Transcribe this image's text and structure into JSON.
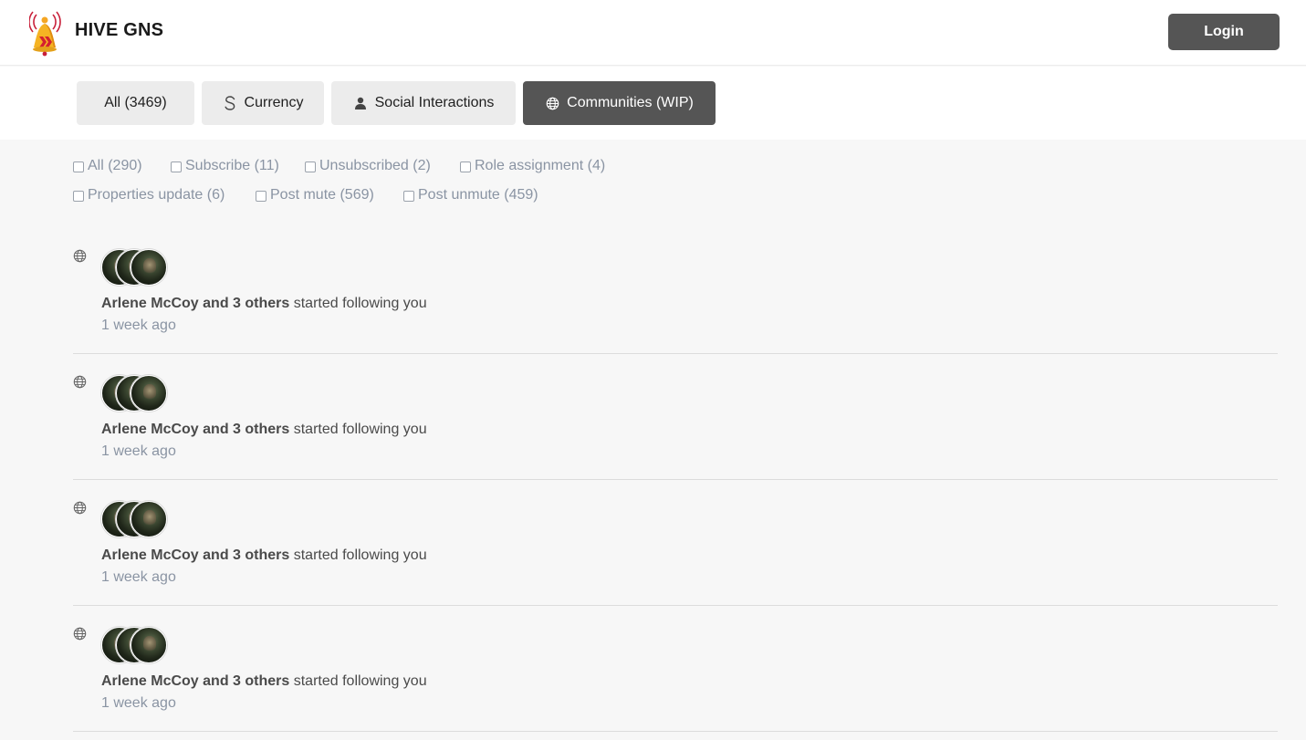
{
  "header": {
    "brand": "HIVE GNS",
    "login_label": "Login"
  },
  "tabs": [
    {
      "label": "All (3469)",
      "icon": "none",
      "active": false
    },
    {
      "label": "Currency",
      "icon": "dollar-icon",
      "active": false
    },
    {
      "label": "Social Interactions",
      "icon": "person-icon",
      "active": false
    },
    {
      "label": "Communities (WIP)",
      "icon": "globe-icon",
      "active": true
    }
  ],
  "filters": [
    {
      "label": "All (290)"
    },
    {
      "label": "Subscribe (11)"
    },
    {
      "label": "Unsubscribed (2)"
    },
    {
      "label": "Role assignment (4)"
    },
    {
      "label": "Properties update (6)"
    },
    {
      "label": "Post mute (569)"
    },
    {
      "label": "Post unmute (459)"
    }
  ],
  "notifications": [
    {
      "actor": "Arlene McCoy and 3 others",
      "action": "started following you",
      "time": "1 week ago",
      "icon": "globe-icon"
    },
    {
      "actor": "Arlene McCoy and 3 others",
      "action": "started following you",
      "time": "1 week ago",
      "icon": "globe-icon"
    },
    {
      "actor": "Arlene McCoy and 3 others",
      "action": "started following you",
      "time": "1 week ago",
      "icon": "globe-icon"
    },
    {
      "actor": "Arlene McCoy and 3 others",
      "action": "started following you",
      "time": "1 week ago",
      "icon": "globe-icon"
    }
  ],
  "colors": {
    "accent_dark": "#555555",
    "tab_bg": "#ececec",
    "muted_text": "#8a94a3",
    "page_bg": "#f7f7f7"
  }
}
